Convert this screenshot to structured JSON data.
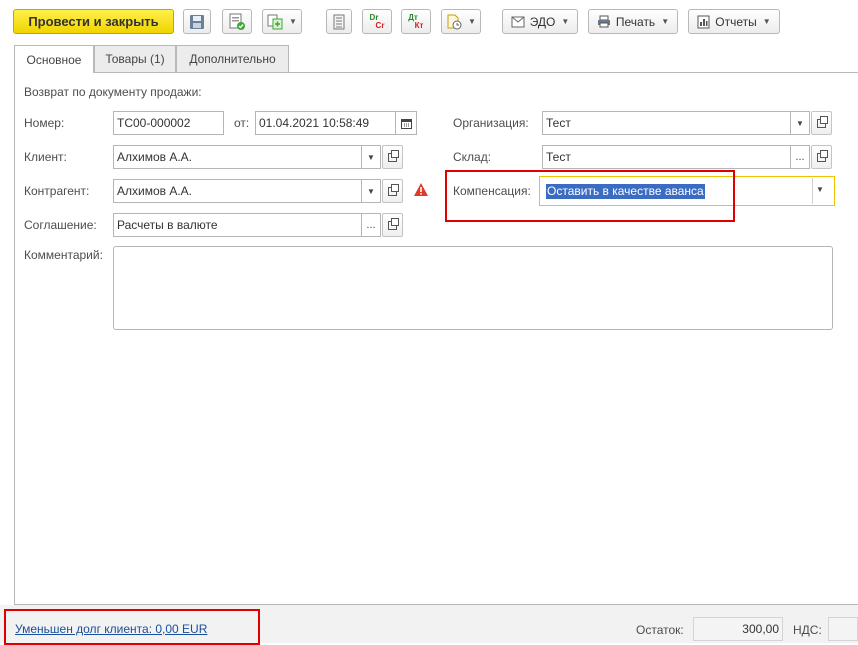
{
  "toolbar": {
    "post_close_label": "Провести и закрыть",
    "edo_label": "ЭДО",
    "print_label": "Печать",
    "reports_label": "Отчеты",
    "dtkt_top": "Дт",
    "dtkt_bottom": "Кт",
    "drcr_top": "Dr",
    "drcr_bottom": "Cr"
  },
  "tabs": [
    "Основное",
    "Товары (1)",
    "Дополнительно"
  ],
  "form": {
    "return_label": "Возврат по документу продажи:",
    "number_label": "Номер:",
    "number_value": "ТС00-000002",
    "from_label": "от:",
    "date_value": "01.04.2021 10:58:49",
    "org_label": "Организация:",
    "org_value": "Тест",
    "client_label": "Клиент:",
    "client_value": "Алхимов А.А.",
    "warehouse_label": "Склад:",
    "warehouse_value": "Тест",
    "contractor_label": "Контрагент:",
    "contractor_value": "Алхимов А.А.",
    "compensation_label": "Компенсация:",
    "compensation_value": "Оставить в качестве аванса",
    "agreement_label": "Соглашение:",
    "agreement_value": "Расчеты в валюте",
    "comment_label": "Комментарий:",
    "comment_value": ""
  },
  "footer": {
    "debt_link": "Уменьшен долг клиента: 0,00 EUR",
    "balance_label": "Остаток:",
    "balance_value": "300,00",
    "vat_label": "НДС:",
    "vat_value": ""
  },
  "colors": {
    "primary_button": "#f5dd10",
    "highlight_border": "#e00000",
    "selection": "#3b6cc4",
    "link": "#1a4f9c"
  }
}
